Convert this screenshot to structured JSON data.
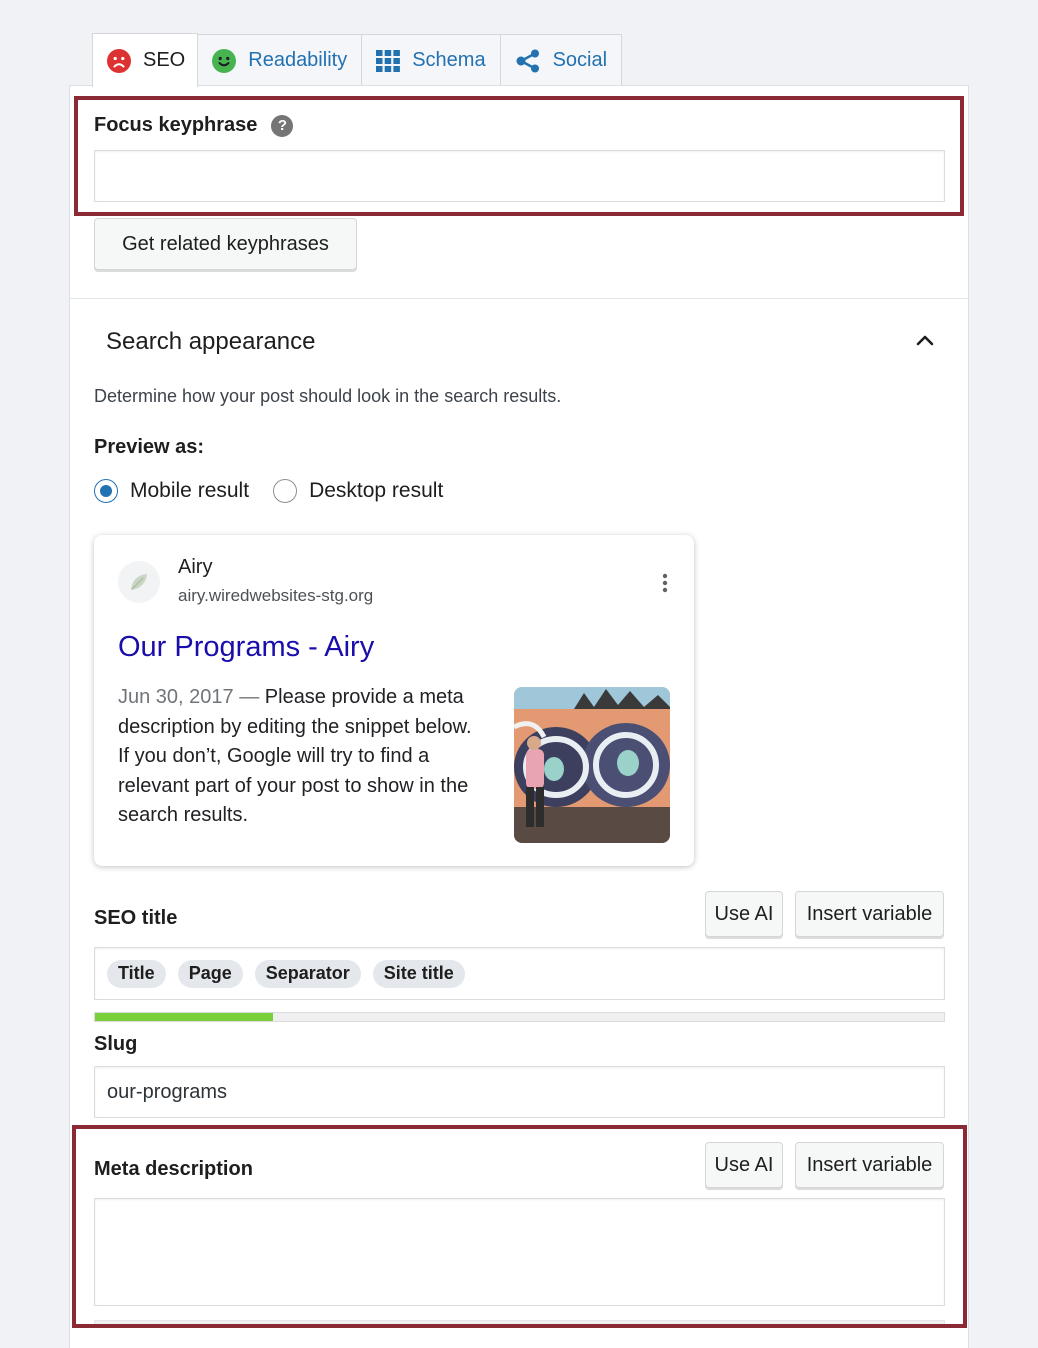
{
  "tabs": [
    {
      "label": "SEO",
      "icon": "sad-face-icon",
      "color": "#dc3232",
      "active": true
    },
    {
      "label": "Readability",
      "icon": "smile-face-icon",
      "color": "#46b450",
      "active": false
    },
    {
      "label": "Schema",
      "icon": "grid-icon",
      "color": "#2271b1",
      "active": false
    },
    {
      "label": "Social",
      "icon": "share-icon",
      "color": "#2271b1",
      "active": false
    }
  ],
  "focus": {
    "label": "Focus keyphrase",
    "help": "?",
    "value": "",
    "related_button": "Get related keyphrases"
  },
  "search_appearance": {
    "heading": "Search appearance",
    "description": "Determine how your post should look in the search results.",
    "preview_label": "Preview as:",
    "options": [
      {
        "label": "Mobile result",
        "checked": true
      },
      {
        "label": "Desktop result",
        "checked": false
      }
    ]
  },
  "serp": {
    "site_name": "Airy",
    "url": "airy.wiredwebsites-stg.org",
    "title": "Our Programs - Airy",
    "date": "Jun 30, 2017",
    "dash": "—",
    "lines": [
      "Please provide a meta",
      "description by editing the snippet below.",
      "If you don’t, Google will try to find a",
      "relevant part of your post to show in the",
      "search results."
    ],
    "title_color": "#1a0dab"
  },
  "seo_title": {
    "label": "SEO title",
    "use_ai": "Use AI",
    "insert_variable": "Insert variable",
    "chips": [
      "Title",
      "Page",
      "Separator",
      "Site title"
    ],
    "progress": 0.21,
    "progress_color": "#7ad03a"
  },
  "slug": {
    "label": "Slug",
    "value": "our-programs"
  },
  "meta": {
    "label": "Meta description",
    "use_ai": "Use AI",
    "insert_variable": "Insert variable",
    "value": ""
  },
  "highlight_color": "#8b2a35"
}
